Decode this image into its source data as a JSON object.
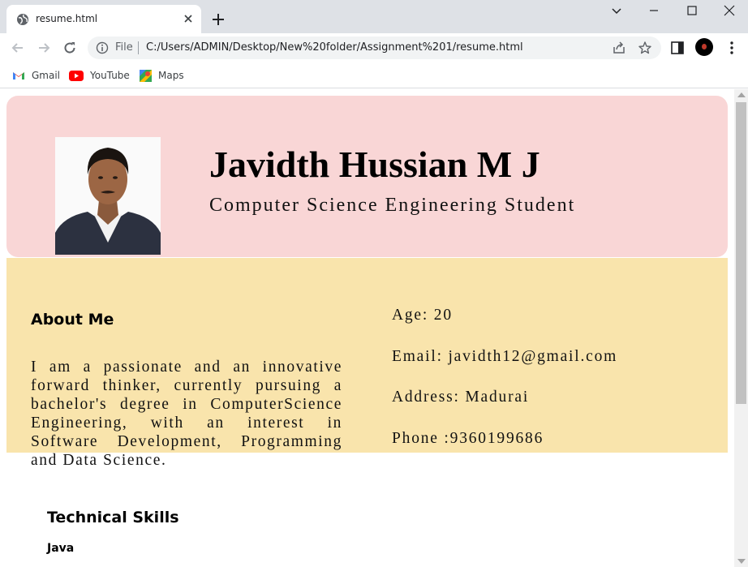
{
  "browser": {
    "tab_title": "resume.html",
    "url_scheme": "File",
    "url": "C:/Users/ADMIN/Desktop/New%20folder/Assignment%201/resume.html",
    "bookmarks": [
      {
        "label": "Gmail",
        "icon": "gmail-icon"
      },
      {
        "label": "YouTube",
        "icon": "youtube-icon"
      },
      {
        "label": "Maps",
        "icon": "maps-icon"
      }
    ]
  },
  "resume": {
    "name": "Javidth Hussian M J",
    "role": "Computer Science Engineering Student",
    "about_heading": "About Me",
    "about_text": "I am a passionate and an innovative forward thinker, currently pursuing a bachelor's degree in ComputerScience Engineering, with an interest in Software Development, Programming and Data Science.",
    "details": {
      "age": "Age: 20",
      "email": "Email: javidth12@gmail.com",
      "address": "Address: Madurai",
      "phone": "Phone :9360199686"
    },
    "skills_heading": "Technical Skills",
    "skills": [
      "Java"
    ]
  },
  "colors": {
    "header_bg": "#f9d6d6",
    "info_band_bg": "#f9e4ac",
    "tabstrip_bg": "#dee1e6"
  }
}
